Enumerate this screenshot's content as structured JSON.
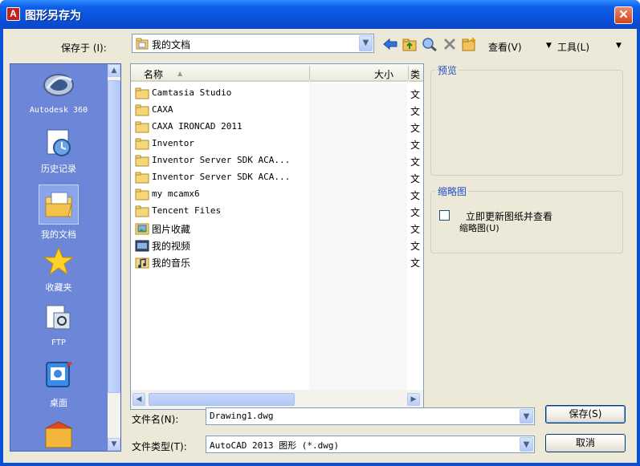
{
  "window": {
    "title": "图形另存为",
    "close_glyph": "✕"
  },
  "toolbar": {
    "save_in_label": "保存于 (I):",
    "current_folder": "我的文档",
    "view_label": "查看(V)",
    "tools_label": "工具(L)",
    "icons": [
      "back-arrow-icon",
      "up-folder-icon",
      "search-web-icon",
      "delete-icon",
      "new-folder-icon",
      "views-menu-icon",
      "tools-menu-icon"
    ]
  },
  "places": [
    {
      "label": "Autodesk 360",
      "icon": "autodesk-360-icon"
    },
    {
      "label": "历史记录",
      "icon": "history-icon"
    },
    {
      "label": "我的文档",
      "icon": "my-documents-icon",
      "active": true
    },
    {
      "label": "收藏夹",
      "icon": "favorites-star-icon"
    },
    {
      "label": "FTP",
      "icon": "ftp-icon"
    },
    {
      "label": "桌面",
      "icon": "desktop-icon"
    },
    {
      "label": "",
      "icon": "mail-folder-icon"
    }
  ],
  "filelist": {
    "columns": {
      "name": "名称",
      "size": "大小",
      "type": "类"
    },
    "rows": [
      {
        "name": "Camtasia Studio",
        "type": "文",
        "icon": "folder-icon"
      },
      {
        "name": "CAXA",
        "type": "文",
        "icon": "folder-icon"
      },
      {
        "name": "CAXA IRONCAD 2011",
        "type": "文",
        "icon": "folder-icon"
      },
      {
        "name": "Inventor",
        "type": "文",
        "icon": "folder-icon"
      },
      {
        "name": "Inventor Server SDK ACA...",
        "type": "文",
        "icon": "folder-icon"
      },
      {
        "name": "Inventor Server SDK ACA...",
        "type": "文",
        "icon": "folder-icon"
      },
      {
        "name": "my mcamx6",
        "type": "文",
        "icon": "folder-icon"
      },
      {
        "name": "Tencent Files",
        "type": "文",
        "icon": "folder-icon"
      },
      {
        "name": "图片收藏",
        "type": "文",
        "icon": "pictures-folder-icon"
      },
      {
        "name": "我的视频",
        "type": "文",
        "icon": "videos-folder-icon"
      },
      {
        "name": "我的音乐",
        "type": "文",
        "icon": "music-folder-icon"
      }
    ]
  },
  "preview": {
    "title": "预览"
  },
  "thumbnail": {
    "title": "缩略图",
    "checkbox_line1": "立即更新图纸并查看",
    "checkbox_line2": "缩略图(U)",
    "checked": false
  },
  "bottom": {
    "filename_label": "文件名(N):",
    "filename_value": "Drawing1.dwg",
    "filetype_label": "文件类型(T):",
    "filetype_value": "AutoCAD 2013 图形 (*.dwg)",
    "save_button": "保存(S)",
    "cancel_button": "取消"
  },
  "colors": {
    "title_bar": "#0a4fd8",
    "places_bar": "#6c87d8",
    "dialog_bg": "#ece9d8",
    "group_title": "#2150c9"
  }
}
